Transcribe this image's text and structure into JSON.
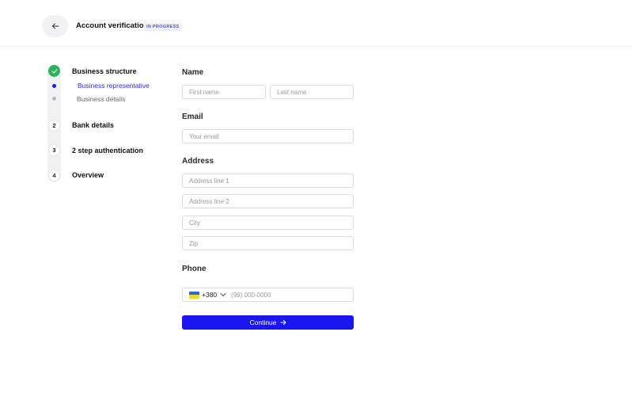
{
  "header": {
    "back_icon": "arrow-left-icon",
    "title": "Account verification",
    "status": "IN PROGRESS"
  },
  "stepper": {
    "steps": [
      {
        "label": "Business structure",
        "state": "completed",
        "icon": "check-icon"
      },
      {
        "label": "Bank details",
        "number": "2",
        "state": "pending"
      },
      {
        "label": "2 step authentication",
        "number": "3",
        "state": "pending"
      },
      {
        "label": "Overview",
        "number": "4",
        "state": "pending"
      }
    ],
    "substeps": [
      {
        "label": "Business representative",
        "state": "active"
      },
      {
        "label": "Business details",
        "state": "pending"
      }
    ]
  },
  "form": {
    "name": {
      "title": "Name",
      "first_placeholder": "First name",
      "last_placeholder": "Last name"
    },
    "email": {
      "title": "Email",
      "placeholder": "Your email"
    },
    "address": {
      "title": "Address",
      "line1_placeholder": "Address line 1",
      "line2_placeholder": "Address line 2",
      "city_placeholder": "City",
      "zip_placeholder": "Zip"
    },
    "phone": {
      "title": "Phone",
      "flag": "ukraine-flag",
      "dial_code": "+380",
      "placeholder": "(99) 000-0000"
    },
    "continue_label": "Continue"
  },
  "colors": {
    "accent": "#1a16f0",
    "success": "#27b45a",
    "badge_text": "#4a52e8",
    "badge_bg": "#eef0ff"
  }
}
